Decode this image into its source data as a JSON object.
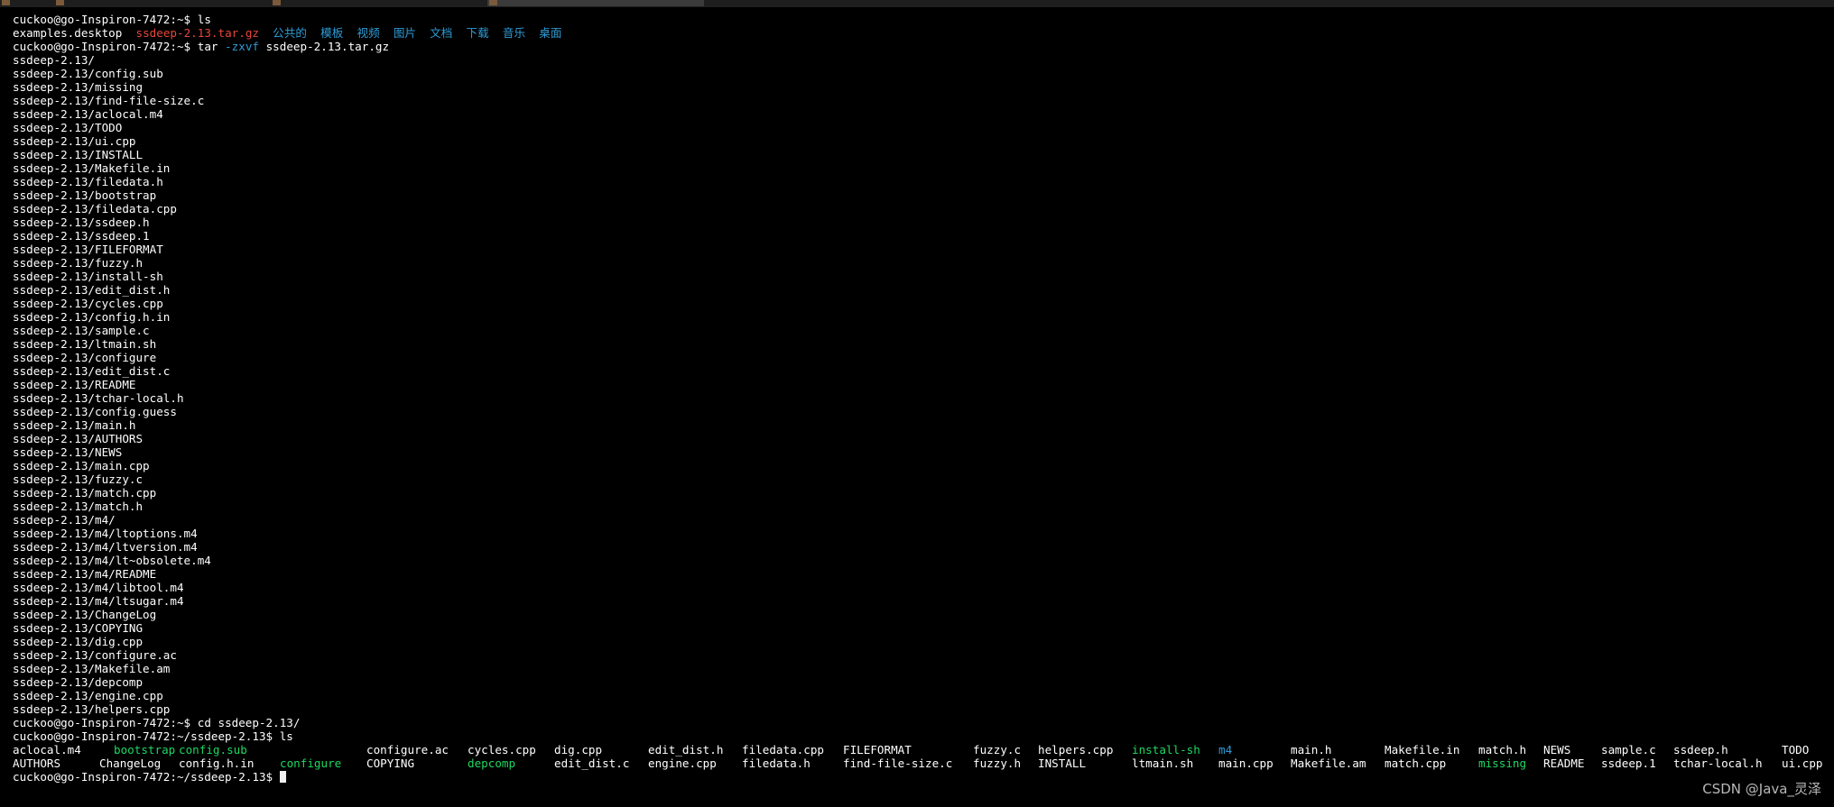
{
  "terminal": {
    "prompt_home": "cuckoo@go-Inspiron-7472:~$",
    "prompt_dir": "cuckoo@go-Inspiron-7472:~/ssdeep-2.13$",
    "cmd_ls": "ls",
    "cmd_tar": "tar",
    "tar_flags": "-zxvf",
    "tar_file": "ssdeep-2.13.tar.gz",
    "cmd_cd": "cd ssdeep-2.13/",
    "home_listing": [
      {
        "text": "examples.desktop",
        "color": "#ffffff"
      },
      {
        "text": "ssdeep-2.13.tar.gz",
        "color": "#e8463a"
      },
      {
        "text": "公共的",
        "color": "#2e9bd6"
      },
      {
        "text": "模板",
        "color": "#2e9bd6"
      },
      {
        "text": "视频",
        "color": "#2e9bd6"
      },
      {
        "text": "图片",
        "color": "#2e9bd6"
      },
      {
        "text": "文档",
        "color": "#2e9bd6"
      },
      {
        "text": "下载",
        "color": "#2e9bd6"
      },
      {
        "text": "音乐",
        "color": "#2e9bd6"
      },
      {
        "text": "桌面",
        "color": "#2e9bd6"
      }
    ],
    "extracted_files": [
      "ssdeep-2.13/",
      "ssdeep-2.13/config.sub",
      "ssdeep-2.13/missing",
      "ssdeep-2.13/find-file-size.c",
      "ssdeep-2.13/aclocal.m4",
      "ssdeep-2.13/TODO",
      "ssdeep-2.13/ui.cpp",
      "ssdeep-2.13/INSTALL",
      "ssdeep-2.13/Makefile.in",
      "ssdeep-2.13/filedata.h",
      "ssdeep-2.13/bootstrap",
      "ssdeep-2.13/filedata.cpp",
      "ssdeep-2.13/ssdeep.h",
      "ssdeep-2.13/ssdeep.1",
      "ssdeep-2.13/FILEFORMAT",
      "ssdeep-2.13/fuzzy.h",
      "ssdeep-2.13/install-sh",
      "ssdeep-2.13/edit_dist.h",
      "ssdeep-2.13/cycles.cpp",
      "ssdeep-2.13/config.h.in",
      "ssdeep-2.13/sample.c",
      "ssdeep-2.13/ltmain.sh",
      "ssdeep-2.13/configure",
      "ssdeep-2.13/edit_dist.c",
      "ssdeep-2.13/README",
      "ssdeep-2.13/tchar-local.h",
      "ssdeep-2.13/config.guess",
      "ssdeep-2.13/main.h",
      "ssdeep-2.13/AUTHORS",
      "ssdeep-2.13/NEWS",
      "ssdeep-2.13/main.cpp",
      "ssdeep-2.13/fuzzy.c",
      "ssdeep-2.13/match.cpp",
      "ssdeep-2.13/match.h",
      "ssdeep-2.13/m4/",
      "ssdeep-2.13/m4/ltoptions.m4",
      "ssdeep-2.13/m4/ltversion.m4",
      "ssdeep-2.13/m4/lt~obsolete.m4",
      "ssdeep-2.13/m4/README",
      "ssdeep-2.13/m4/libtool.m4",
      "ssdeep-2.13/m4/ltsugar.m4",
      "ssdeep-2.13/ChangeLog",
      "ssdeep-2.13/COPYING",
      "ssdeep-2.13/dig.cpp",
      "ssdeep-2.13/configure.ac",
      "ssdeep-2.13/Makefile.am",
      "ssdeep-2.13/depcomp",
      "ssdeep-2.13/engine.cpp",
      "ssdeep-2.13/helpers.cpp"
    ],
    "dir_listing_row1": [
      {
        "text": "aclocal.m4",
        "color": "#ffffff"
      },
      {
        "text": "bootstrap",
        "color": "#1ed760"
      },
      {
        "text": "config.sub",
        "color": "#1ed760"
      },
      {
        "text": "configure.ac",
        "color": "#ffffff"
      },
      {
        "text": "cycles.cpp",
        "color": "#ffffff"
      },
      {
        "text": "dig.cpp",
        "color": "#ffffff"
      },
      {
        "text": "edit_dist.h",
        "color": "#ffffff"
      },
      {
        "text": "filedata.cpp",
        "color": "#ffffff"
      },
      {
        "text": "FILEFORMAT",
        "color": "#ffffff"
      },
      {
        "text": "fuzzy.c",
        "color": "#ffffff"
      },
      {
        "text": "helpers.cpp",
        "color": "#ffffff"
      },
      {
        "text": "install-sh",
        "color": "#1ed760"
      },
      {
        "text": "m4",
        "color": "#2e9bd6"
      },
      {
        "text": "main.h",
        "color": "#ffffff"
      },
      {
        "text": "Makefile.in",
        "color": "#ffffff"
      },
      {
        "text": "match.h",
        "color": "#ffffff"
      },
      {
        "text": "NEWS",
        "color": "#ffffff"
      },
      {
        "text": "sample.c",
        "color": "#ffffff"
      },
      {
        "text": "ssdeep.h",
        "color": "#ffffff"
      },
      {
        "text": "TODO",
        "color": "#ffffff"
      }
    ],
    "dir_listing_row2": [
      {
        "text": "AUTHORS",
        "color": "#ffffff"
      },
      {
        "text": "ChangeLog",
        "color": "#ffffff"
      },
      {
        "text": "config.h.in",
        "color": "#ffffff"
      },
      {
        "text": "configure",
        "color": "#1ed760"
      },
      {
        "text": "COPYING",
        "color": "#ffffff"
      },
      {
        "text": "depcomp",
        "color": "#1ed760"
      },
      {
        "text": "edit_dist.c",
        "color": "#ffffff"
      },
      {
        "text": "engine.cpp",
        "color": "#ffffff"
      },
      {
        "text": "filedata.h",
        "color": "#ffffff"
      },
      {
        "text": "find-file-size.c",
        "color": "#ffffff"
      },
      {
        "text": "fuzzy.h",
        "color": "#ffffff"
      },
      {
        "text": "INSTALL",
        "color": "#ffffff"
      },
      {
        "text": "ltmain.sh",
        "color": "#ffffff"
      },
      {
        "text": "main.cpp",
        "color": "#ffffff"
      },
      {
        "text": "Makefile.am",
        "color": "#ffffff"
      },
      {
        "text": "match.cpp",
        "color": "#ffffff"
      },
      {
        "text": "missing",
        "color": "#1ed760"
      },
      {
        "text": "README",
        "color": "#ffffff"
      },
      {
        "text": "ssdeep.1",
        "color": "#ffffff"
      },
      {
        "text": "tchar-local.h",
        "color": "#ffffff"
      },
      {
        "text": "ui.cpp",
        "color": "#ffffff"
      }
    ]
  },
  "watermark": "CSDN @Java_灵泽"
}
